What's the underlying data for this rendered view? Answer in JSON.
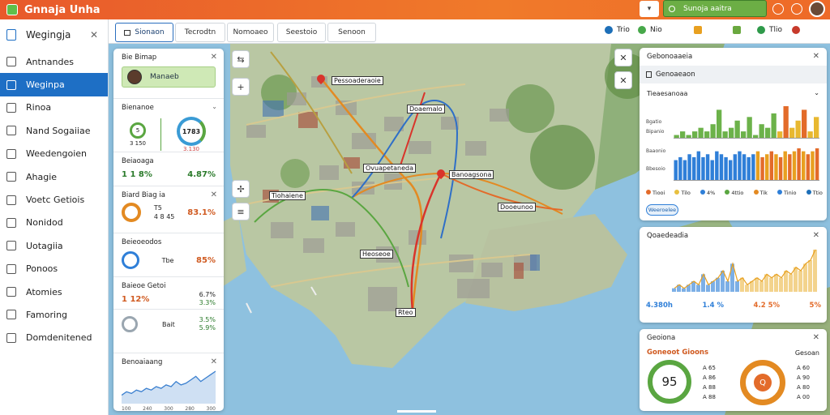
{
  "app": {
    "title": "Gnnaja Unha"
  },
  "topbar": {
    "dropdown_icon": "chevron-down-icon",
    "search_label": "Sunoja aaitra"
  },
  "sidebar": {
    "title": "Wegingja",
    "items": [
      {
        "label": "Antnandes",
        "icon": "layers-icon"
      },
      {
        "label": "Weginpa",
        "icon": "map-icon",
        "active": true
      },
      {
        "label": "Rinoa",
        "icon": "grid-icon"
      },
      {
        "label": "Nand Sogaiiae",
        "icon": "image-icon"
      },
      {
        "label": "Weedengoien",
        "icon": "list-icon"
      },
      {
        "label": "Ahagie",
        "icon": "chart-icon"
      },
      {
        "label": "Voetc Getiois",
        "icon": "document-icon"
      },
      {
        "label": "Nonidod",
        "icon": "folder-icon"
      },
      {
        "label": "Uotagiia",
        "icon": "table-icon"
      },
      {
        "label": "Ponoos",
        "icon": "text-icon"
      },
      {
        "label": "Atomies",
        "icon": "settings-icon"
      },
      {
        "label": "Famoring",
        "icon": "clock-icon"
      },
      {
        "label": "Domdenitened",
        "icon": "gear-icon"
      }
    ]
  },
  "tabs": [
    {
      "label": "Sionaon",
      "active": true
    },
    {
      "label": "Tecrodtn"
    },
    {
      "label": "Nomoaeo"
    },
    {
      "label": "Seestoio"
    },
    {
      "label": "Senoon"
    }
  ],
  "tab_stats": [
    {
      "label": "Trio",
      "color": "#1d6fb8"
    },
    {
      "label": "Nio",
      "color": "#47a84a"
    },
    {
      "label": "",
      "color": "#e8a020"
    },
    {
      "label": "",
      "color": "#6aa83f"
    },
    {
      "label": "Tlio",
      "color": "#2f9a4a"
    },
    {
      "label": "",
      "color": "#c73a2b"
    }
  ],
  "map": {
    "labels": [
      "Pessoaderaoie",
      "Doaemalo",
      "Ovuapetaneda",
      "Banoagsona",
      "Tiohaiene",
      "Dooeunoo",
      "Heoseoe",
      "Rteo"
    ],
    "route_colors": [
      "#d9342b",
      "#2f6fc7",
      "#e38a22",
      "#5aa641",
      "#b8a040"
    ]
  },
  "left_panel": {
    "section1": {
      "title": "Bie Bimap",
      "user": "Manaeb"
    },
    "section2": {
      "title": "Bienanoe",
      "ring_a": "5",
      "ring_a_sub": "3 150",
      "ring_b": "1783",
      "ring_b_sub": "3.130"
    },
    "section3": {
      "title": "Beiaoaga",
      "value_a": "1 1 8%",
      "value_b": "4.87%"
    },
    "section4": {
      "title": "Biard Biag ia",
      "ring_label": "T5",
      "sub": "4 8 45",
      "value": "83.1%"
    },
    "section5": {
      "title": "Beieoeodos",
      "ring_label": "Tbe",
      "value": "85%"
    },
    "section6": {
      "title": "Baieoe Getoi",
      "value_a": "1 12%",
      "value_b": "6.7%",
      "value_c": "3.3%"
    },
    "section7": {
      "title": "Bait",
      "value_a": "3.5%",
      "value_b": "5.9%"
    },
    "section8": {
      "title": "Benoaiaang",
      "axis": [
        "100",
        "240",
        "300",
        "280",
        "300"
      ]
    }
  },
  "right_cards": {
    "card1": {
      "title": "Gebonoaaeia",
      "subtitle": "Genoaeaon",
      "section": "Tieaesanoaa",
      "ylabels": [
        "Bgatio",
        "Bipanio",
        "Baaonio",
        "Bbesoio"
      ],
      "legend": [
        {
          "label": "Tiooi",
          "color": "#e36b2a"
        },
        {
          "label": "Tilo",
          "color": "#e8c040"
        },
        {
          "label": "4%",
          "color": "#2f7fd8"
        },
        {
          "label": "4ttio",
          "color": "#5aa641"
        },
        {
          "label": "Tik",
          "color": "#e38a22"
        },
        {
          "label": "Tinio",
          "color": "#2f7fd8"
        },
        {
          "label": "Ttio",
          "color": "#1d6fb8"
        }
      ],
      "button": "Weeroelee"
    },
    "card2": {
      "title": "Qoaedeadia",
      "values": [
        {
          "label": "4.380h",
          "color": "#2f7fd8"
        },
        {
          "label": "1.4 %",
          "color": "#2f7fd8"
        },
        {
          "label": "4.2 5%",
          "color": "#e36b2a"
        },
        {
          "label": "5%",
          "color": "#e36b2a"
        }
      ]
    },
    "card3": {
      "title": "Geoiona",
      "subtitle": "Goneoot Gioons",
      "right_label": "Gesoan",
      "gauge_a": "95",
      "gauge_b": "Q",
      "list_a": [
        "A 65",
        "A 86",
        "A 88",
        "A 88"
      ],
      "list_b": [
        "A 60",
        "A 90",
        "A 80",
        "A 00"
      ]
    }
  },
  "chart_data": [
    {
      "type": "bar",
      "title": "Tieaesanoaa",
      "series": [
        {
          "values": [
            1,
            2,
            1,
            2,
            3,
            2,
            4,
            8,
            2,
            3,
            5,
            2,
            6,
            1,
            4,
            3,
            7,
            2,
            9,
            3,
            5,
            8,
            2,
            6
          ]
        }
      ]
    },
    {
      "type": "bar",
      "series": [
        {
          "values": [
            7,
            8,
            7,
            9,
            8,
            10,
            8,
            9,
            7,
            10,
            9,
            8,
            7,
            9,
            10,
            9,
            8,
            9,
            10,
            8,
            9,
            10,
            9,
            8,
            10,
            9,
            10,
            11,
            10,
            9,
            10,
            11
          ]
        }
      ]
    },
    {
      "type": "area",
      "title": "Qoaedeadia",
      "series": [
        {
          "values": [
            1,
            2,
            1,
            2,
            3,
            2,
            5,
            2,
            3,
            4,
            6,
            3,
            8,
            3,
            4,
            2,
            3,
            4,
            3,
            5,
            4,
            5,
            4,
            6,
            5,
            7,
            6,
            8,
            9,
            12
          ]
        }
      ]
    },
    {
      "type": "line",
      "title": "Benoaiaang",
      "series": [
        {
          "values": [
            4,
            6,
            5,
            7,
            6,
            8,
            7,
            9,
            8,
            10,
            9,
            12,
            10,
            11,
            13,
            15,
            12,
            14,
            16,
            18
          ]
        }
      ]
    }
  ]
}
